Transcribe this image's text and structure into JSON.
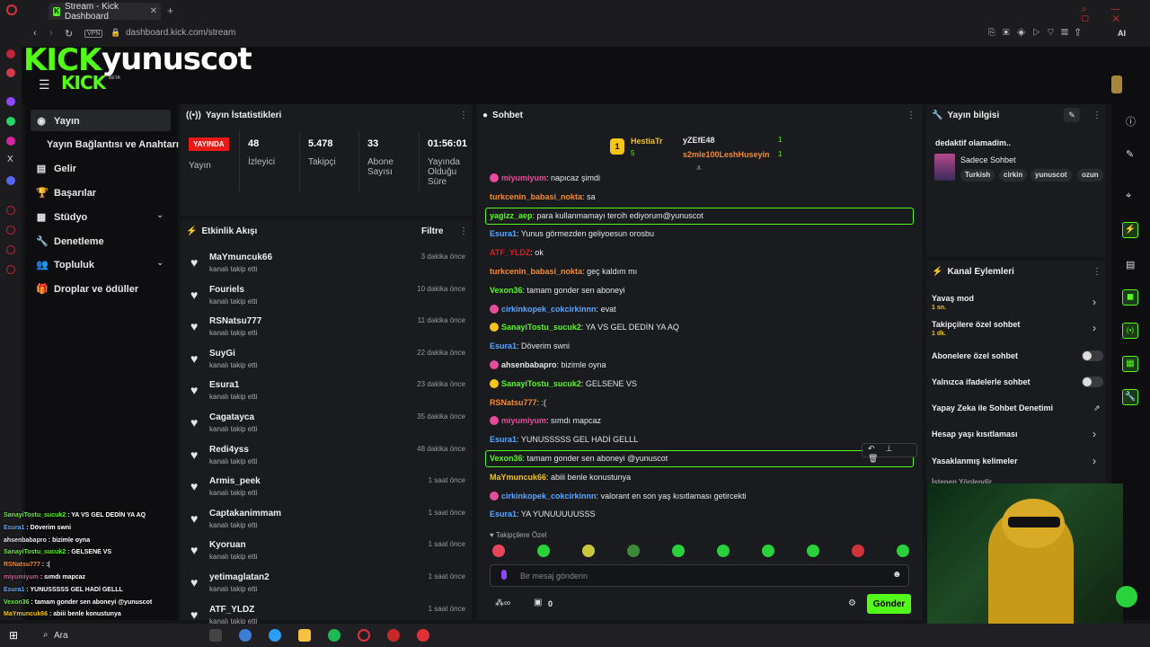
{
  "browser": {
    "tab_title": "Stream - Kick Dashboard",
    "url": "dashboard.kick.com/stream",
    "vpn": "VPN",
    "ai": "AI"
  },
  "header": {
    "logo": "KICK",
    "logo_small": "KICK",
    "beta": "BETA",
    "username": "yunuscot"
  },
  "nav": {
    "items": [
      {
        "label": "Yayın",
        "icon": "play-icon"
      },
      {
        "label": "Yayın Bağlantısı ve Anahtarı"
      },
      {
        "label": "Gelir",
        "icon": "chart-icon"
      },
      {
        "label": "Başarılar",
        "icon": "trophy-icon"
      },
      {
        "label": "Stüdyo",
        "icon": "grid-icon"
      },
      {
        "label": "Denetleme",
        "icon": "wrench-icon"
      },
      {
        "label": "Topluluk",
        "icon": "people-icon"
      },
      {
        "label": "Droplar ve ödüller",
        "icon": "gift-icon"
      }
    ]
  },
  "stats": {
    "title": "Yayın İstatistikleri",
    "live": "YAYINDA",
    "status_label": "Yayın",
    "viewers": "48",
    "viewers_label": "İzleyici",
    "followers": "5.478",
    "followers_label": "Takipçi",
    "subs": "33",
    "subs_label": "Abone Sayısı",
    "uptime": "01:56:01",
    "uptime_label": "Yayında Olduğu Süre"
  },
  "activity": {
    "title": "Etkinlik Akışı",
    "filter": "Filtre",
    "items": [
      {
        "name": "MaYmuncuk66",
        "sub": "kanalı takip etti",
        "time": "3 dakika önce"
      },
      {
        "name": "Fouriels",
        "sub": "kanalı takip etti",
        "time": "10 dakika önce"
      },
      {
        "name": "RSNatsu777",
        "sub": "kanalı takip etti",
        "time": "11 dakika önce"
      },
      {
        "name": "SuyGi",
        "sub": "kanalı takip etti",
        "time": "22 dakika önce"
      },
      {
        "name": "Esura1",
        "sub": "kanalı takip etti",
        "time": "23 dakika önce"
      },
      {
        "name": "Cagatayca",
        "sub": "kanalı takip etti",
        "time": "35 dakika önce"
      },
      {
        "name": "Redi4yss",
        "sub": "kanalı takip etti",
        "time": "48 dakika önce"
      },
      {
        "name": "Armis_peek",
        "sub": "kanalı takip etti",
        "time": "1 saat önce"
      },
      {
        "name": "Captakanimmam",
        "sub": "kanalı takip etti",
        "time": "1 saat önce"
      },
      {
        "name": "Kyoruan",
        "sub": "kanalı takip etti",
        "time": "1 saat önce"
      },
      {
        "name": "yetimaglatan2",
        "sub": "kanalı takip etti",
        "time": "1 saat önce"
      },
      {
        "name": "ATF_YLDZ",
        "sub": "kanalı takip etti",
        "time": "1 saat önce"
      }
    ]
  },
  "chat": {
    "title": "Sohbet",
    "top": [
      {
        "name": "HestiaTr",
        "count": "5"
      },
      {
        "name": "yZEfE48",
        "count": "1"
      },
      {
        "name": "s2mle100LeshHuseyin",
        "count": "1"
      }
    ],
    "messages": [
      {
        "user": "miyumiyum",
        "text": "napıcaz şimdi",
        "color": "#e64c9c"
      },
      {
        "user": "turkcenin_babasi_nokta",
        "text": "sa",
        "color": "#f28b30"
      },
      {
        "user": "yagizz_aep",
        "text": "para kullanmamayı tercih ediyorum@yunuscot",
        "color": "#53fc18"
      },
      {
        "user": "Esura1",
        "text": "Yunus görmezden geliyoesun orosbu",
        "color": "#5aa7ff"
      },
      {
        "user": "ATF_YLDZ",
        "text": "ok",
        "color": "#e91916"
      },
      {
        "user": "turkcenin_babasi_nokta",
        "text": "geç kaldım mı",
        "color": "#f28b30"
      },
      {
        "user": "Vexon36",
        "text": "tamam gonder sen aboneyi",
        "color": "#53fc18"
      },
      {
        "user": "cirkinkopek_cokcirkinnn",
        "text": "evat",
        "color": "#5aa7ff"
      },
      {
        "user": "SanayiTostu_sucuk2",
        "text": "YA VS GEL DEDİN YA AQ",
        "color": "#53fc18"
      },
      {
        "user": "Esura1",
        "text": "Döverim swni",
        "color": "#5aa7ff"
      },
      {
        "user": "ahsenbabapro",
        "text": "bizimle oyna",
        "color": "#e6e6e6"
      },
      {
        "user": "SanayiTostu_sucuk2",
        "text": "GELSENE VS",
        "color": "#53fc18"
      },
      {
        "user": "RSNatsu777",
        "text": ":(",
        "color": "#f28b30"
      },
      {
        "user": "miyumiyum",
        "text": "sımdı mapcaz",
        "color": "#e64c9c"
      },
      {
        "user": "Esura1",
        "text": "YUNUSSSSS GEL HADİ GELLL",
        "color": "#5aa7ff"
      },
      {
        "user": "Vexon36",
        "text": "tamam gonder sen aboneyi @yunuscot",
        "color": "#53fc18"
      },
      {
        "user": "MaYmuncuk66",
        "text": "abiii benle konustunya",
        "color": "#f5c518"
      },
      {
        "user": "cirkinkopek_cokcirkinnn",
        "text": "valorant en son yaş kısıtlaması getircekti",
        "color": "#5aa7ff"
      },
      {
        "user": "Esura1",
        "text": "YA YUNUUUUUSSS",
        "color": "#5aa7ff"
      }
    ],
    "followers_only": "Takipçilere Özel",
    "placeholder": "Bir mesaj gönderin",
    "send": "Gönder",
    "zero": "0"
  },
  "stream_info": {
    "title": "Yayın bilgisi",
    "stream_title": "dedaktif olamadim..",
    "category": "Sadece Sohbet",
    "tags": [
      "Turkish",
      "cirkin",
      "yunuscot",
      "ozun"
    ]
  },
  "channel_actions": {
    "title": "Kanal Eylemleri",
    "items": [
      {
        "label": "Yavaş mod",
        "sub": "1 sn."
      },
      {
        "label": "Takipçilere özel sohbet",
        "sub": "1 dk."
      },
      {
        "label": "Abonelere özel sohbet"
      },
      {
        "label": "Yalnızca ifadelerle sohbet"
      },
      {
        "label": "Yapay Zeka ile Sohbet Denetimi"
      },
      {
        "label": "Hesap yaşı kısıtlaması"
      },
      {
        "label": "Yasaklanmış kelimeler"
      },
      {
        "label": "İstenen Yönlendir"
      }
    ]
  },
  "overlay": {
    "lines": [
      {
        "user": "SanayiTostu_sucuk2",
        "text": "YA VS GEL DEDİN YA AQ",
        "color": "#53fc18"
      },
      {
        "user": "Esura1",
        "text": "Döverim swni",
        "color": "#5aa7ff"
      },
      {
        "user": "ahsenbabapro",
        "text": "bizimle oyna",
        "color": "#e6e6e6"
      },
      {
        "user": "SanayiTostu_sucuk2",
        "text": "GELSENE VS",
        "color": "#53fc18"
      },
      {
        "user": "RSNatsu777",
        "text": ":(",
        "color": "#f28b30"
      },
      {
        "user": "miyumiyum",
        "text": "sımdı mapcaz",
        "color": "#e64c9c"
      },
      {
        "user": "Esura1",
        "text": "YUNUSSSSS GEL HADİ GELLL",
        "color": "#5aa7ff"
      },
      {
        "user": "Vexon36",
        "text": "tamam gonder sen aboneyi @yunuscot",
        "color": "#53fc18"
      },
      {
        "user": "MaYmuncuk66",
        "text": "abiii benle konustunya",
        "color": "#f5c518"
      }
    ]
  },
  "taskbar": {
    "search": "Ara"
  }
}
